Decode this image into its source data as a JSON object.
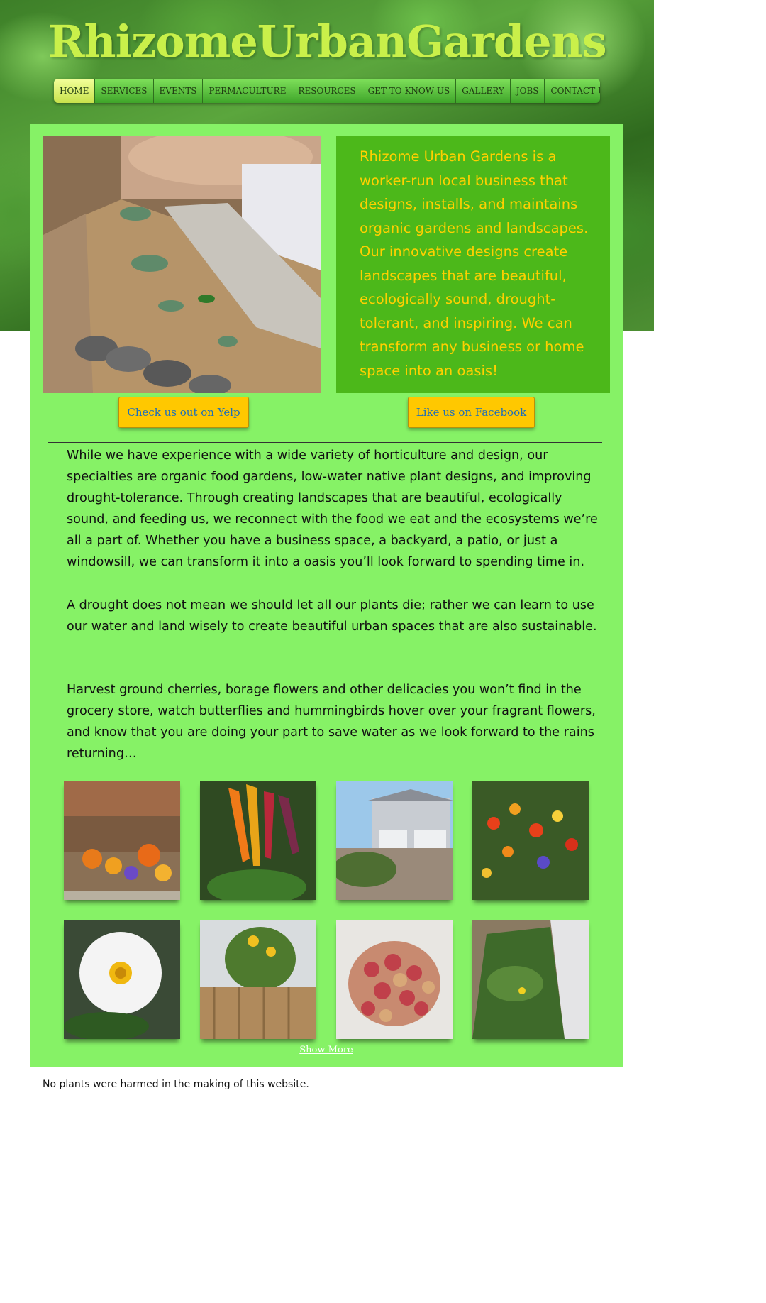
{
  "header": {
    "site_title": "RhizomeUrbanGardens"
  },
  "nav": {
    "items": [
      {
        "label": "HOME",
        "active": true
      },
      {
        "label": "SERVICES",
        "active": false
      },
      {
        "label": "EVENTS",
        "active": false
      },
      {
        "label": "PERMACULTURE",
        "active": false
      },
      {
        "label": "RESOURCES",
        "active": false
      },
      {
        "label": "GET TO KNOW US",
        "active": false
      },
      {
        "label": "GALLERY",
        "active": false
      },
      {
        "label": "JOBS",
        "active": false
      },
      {
        "label": "CONTACT US",
        "active": false
      }
    ]
  },
  "intro": {
    "text": "Rhizome Urban Gardens is a worker-run local business that designs, installs, and maintains organic gardens and landscapes. Our innovative designs create landscapes that are beautiful, ecologically sound, drought-tolerant, and inspiring. We can transform any business or home space into an oasis!"
  },
  "cta": {
    "yelp_label": "Check us out on Yelp",
    "facebook_label": "Like us on Facebook"
  },
  "content": {
    "paragraph1": "While we have experience with a wide variety of horticulture and design, our specialties are organic food gardens, low-water native plant designs, and improving drought-tolerance. Through creating landscapes that are beautiful, ecologically sound, and feeding us, we reconnect with the food we eat and the ecosystems we’re all a part of. Whether you have a business space, a backyard, a patio, or just a windowsill, we can transform it into a oasis you’ll look forward to spending time in.",
    "paragraph2": "A drought does not mean we should let all our plants die; rather we can learn to use our water and land wisely to create beautiful urban spaces that are also sustainable.",
    "paragraph3": "Harvest ground cherries, borage flowers and other delicacies you won’t find in the grocery store, watch butterflies and hummingbirds hover over your fragrant flowers, and know that you are doing your part to save water as we look forward to the rains returning…"
  },
  "gallery": {
    "show_more_label": "Show More"
  },
  "footer": {
    "text": "No plants were harmed in the making of this website."
  },
  "colors": {
    "panel": "#86f266",
    "intro_box": "#4cb81a",
    "intro_text": "#ffd000",
    "cta_bg": "#ffc800",
    "cta_text": "#1e6fb8",
    "logo": "#c9f04a"
  }
}
